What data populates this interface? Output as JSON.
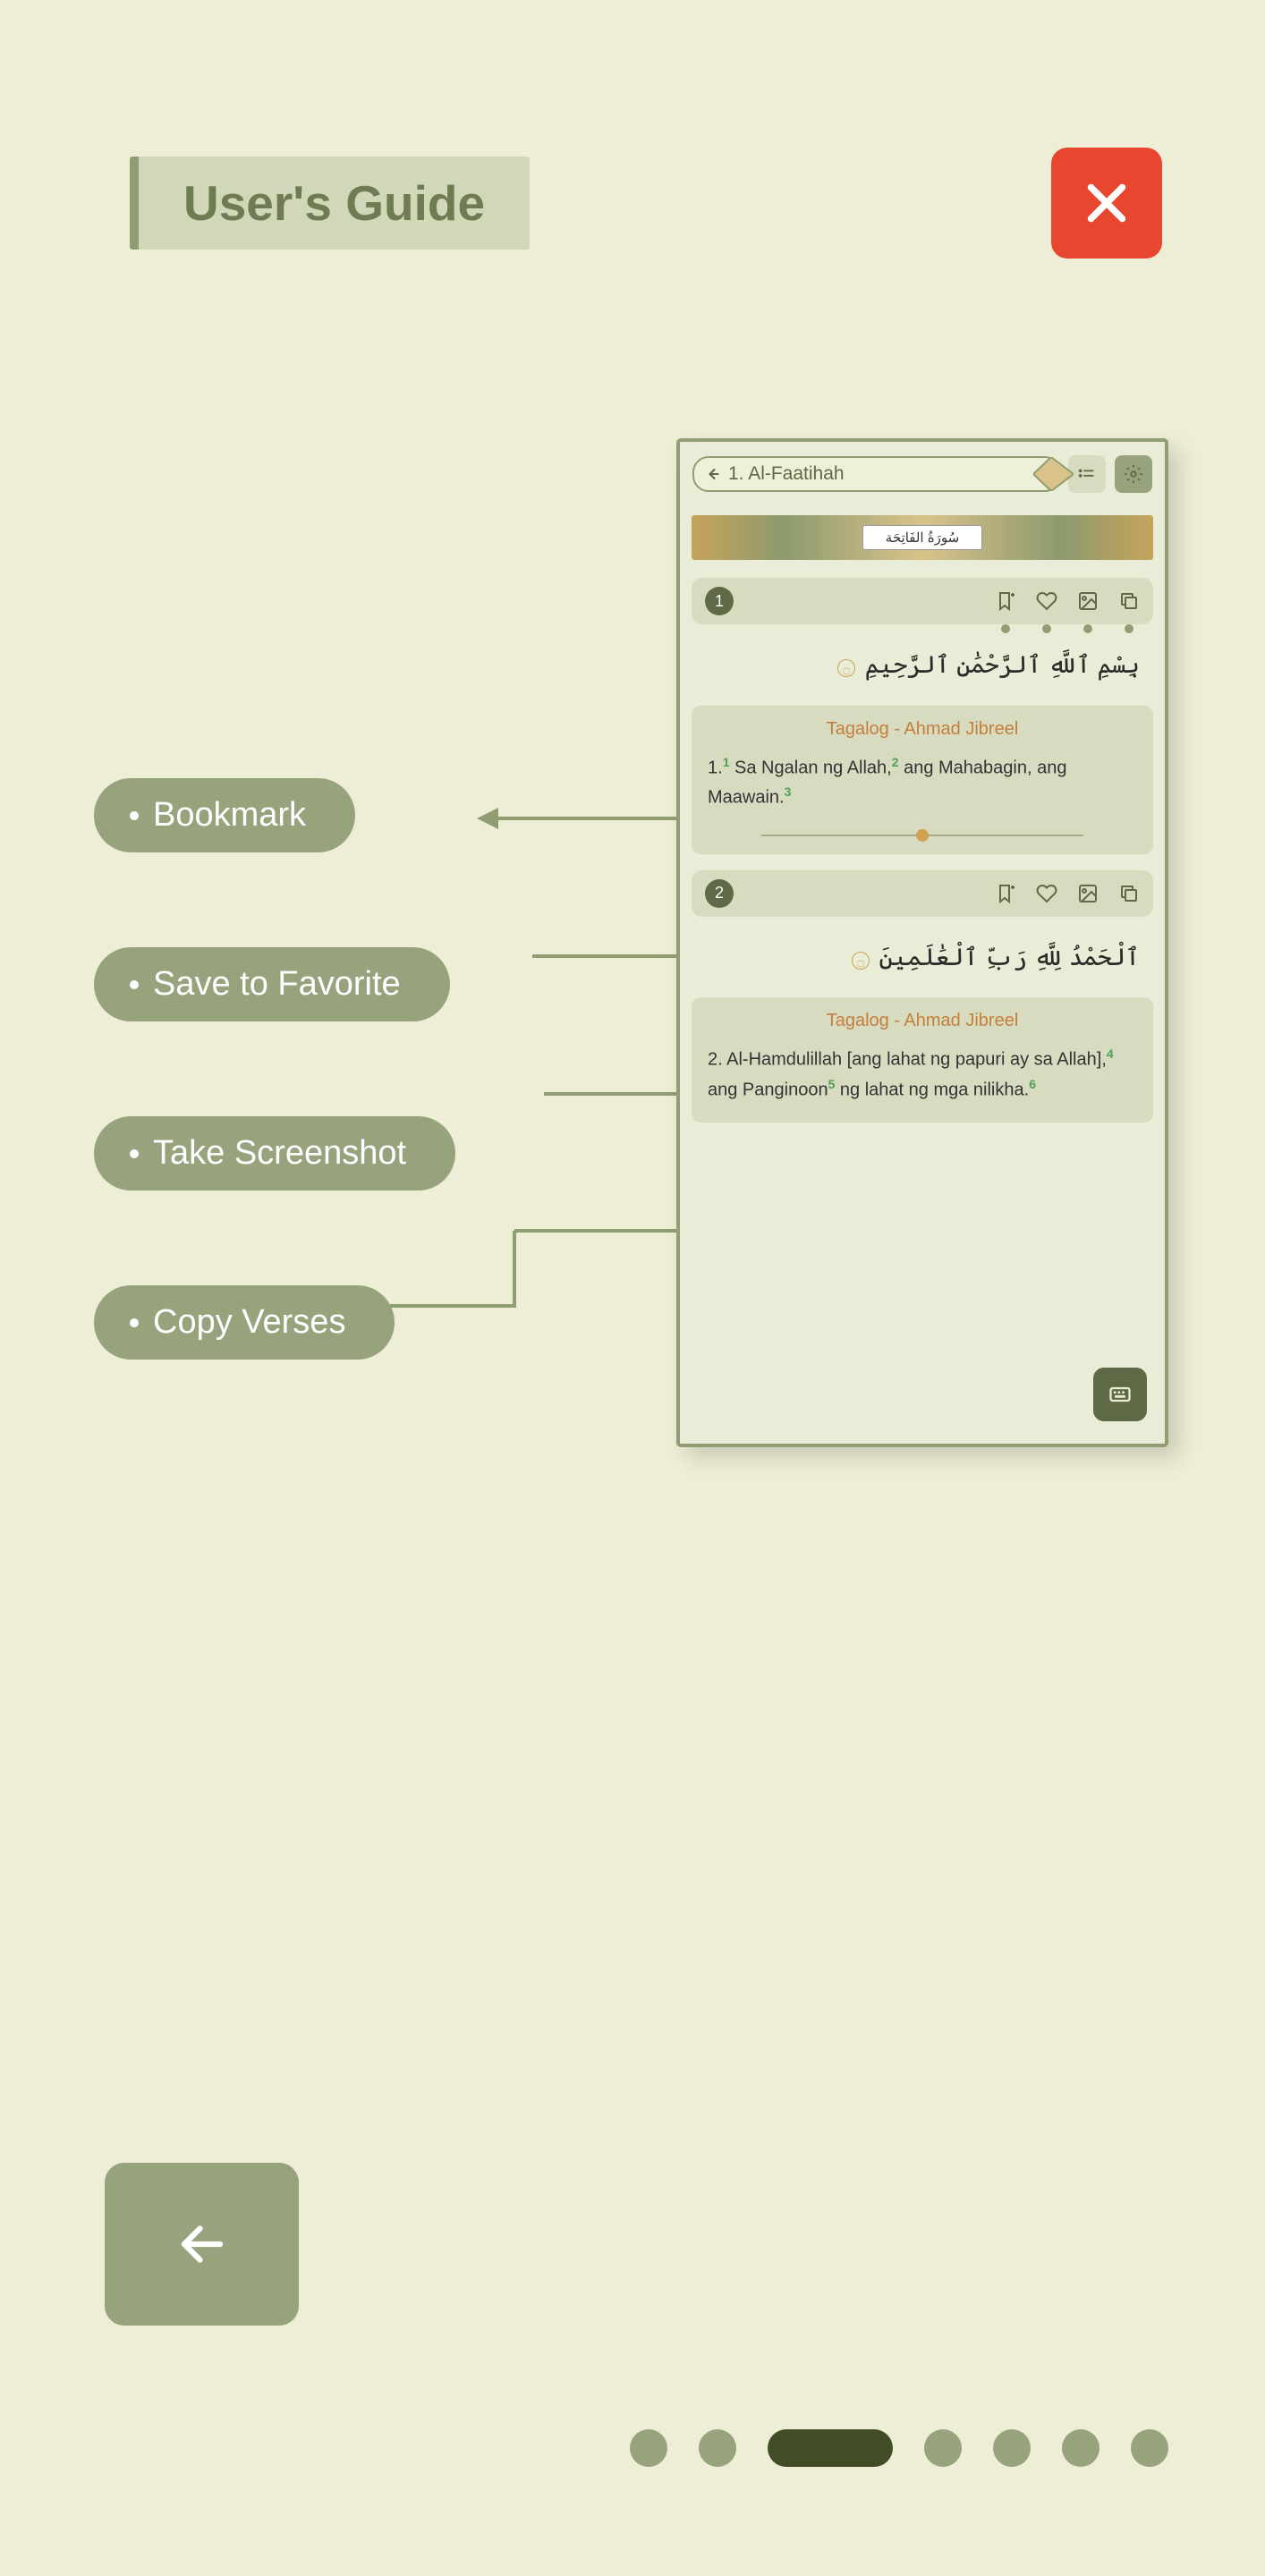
{
  "header": {
    "title": "User's Guide"
  },
  "callouts": [
    "Bookmark",
    "Save to Favorite",
    "Take Screenshot",
    "Copy Verses"
  ],
  "phone": {
    "nav_title": "1. Al-Faatihah",
    "surah_arabic": "سُورَةُ الفَاتِحَة",
    "verses": [
      {
        "num": "1",
        "arabic": "بِسْمِ ٱللَّهِ ٱلرَّحْمَٰنِ ٱلرَّحِيمِ",
        "translation_label": "Tagalog - Ahmad Jibreel",
        "translation": "1.<sup>1</sup> Sa Ngalan ng Allah,<sup>2</sup> ang Mahabagin, ang Maawain.<sup>3</sup>"
      },
      {
        "num": "2",
        "arabic": "ٱلْحَمْدُ لِلَّهِ رَبِّ ٱلْعَٰلَمِينَ",
        "translation_label": "Tagalog - Ahmad Jibreel",
        "translation": "2. Al-Hamdulillah [ang lahat ng papuri ay sa Allah],<sup>4</sup> ang Panginoon<sup>5</sup> ng lahat ng mga nilikha.<sup>6</sup>"
      }
    ]
  },
  "pagination": {
    "total": 7,
    "active": 3
  }
}
